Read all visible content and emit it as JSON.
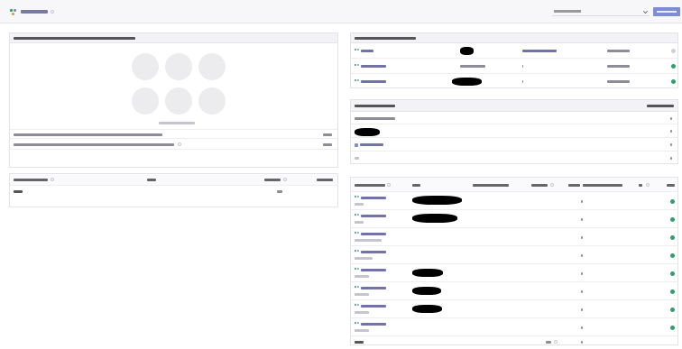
{
  "app": {
    "title": "",
    "project_filter": "",
    "new_button": ""
  },
  "colors": {
    "accent": "#7e8cd4",
    "success": "#2ea06a",
    "muted": "#cfcfd6",
    "redacted": "#000000"
  },
  "stats_panel": {
    "title": "",
    "empty_message": "",
    "rows": [
      {
        "label": "",
        "value": ""
      },
      {
        "label": "",
        "value": ""
      }
    ]
  },
  "left_table": {
    "headers": [
      "",
      "",
      "",
      ""
    ],
    "total": {
      "label": "",
      "value": ""
    }
  },
  "recent_projects": {
    "title": "",
    "rows": [
      {
        "code": "",
        "client": "",
        "status_label": "",
        "date": "",
        "state": "muted"
      },
      {
        "code": "",
        "client": "",
        "status_label": "",
        "date": "",
        "state": "success"
      },
      {
        "code": "",
        "client": "",
        "status_label": "",
        "date": "",
        "state": "success"
      }
    ]
  },
  "projects_by_tier": {
    "title": "",
    "count_header": "",
    "rows": [
      {
        "label": "",
        "count": ""
      },
      {
        "label": "",
        "count": ""
      },
      {
        "label": "",
        "count": ""
      },
      {
        "label": "",
        "count": ""
      }
    ]
  },
  "open_projects": {
    "headers": [
      "",
      "",
      "",
      "",
      "",
      "",
      "",
      ""
    ],
    "rows": [
      {
        "code": "",
        "subtitle": "",
        "tasks": "",
        "state": "success"
      },
      {
        "code": "",
        "subtitle": "",
        "tasks": "",
        "state": "success"
      },
      {
        "code": "",
        "subtitle": "",
        "tasks": "",
        "state": "success"
      },
      {
        "code": "",
        "subtitle": "",
        "tasks": "",
        "state": "success"
      },
      {
        "code": "",
        "subtitle": "",
        "tasks": "",
        "state": "success"
      },
      {
        "code": "",
        "subtitle": "",
        "tasks": "",
        "state": "success"
      },
      {
        "code": "",
        "subtitle": "",
        "tasks": "",
        "state": "success"
      },
      {
        "code": "",
        "subtitle": "",
        "tasks": "",
        "state": "success"
      }
    ],
    "total": {
      "label": "",
      "value": "",
      "tasks": ""
    }
  }
}
